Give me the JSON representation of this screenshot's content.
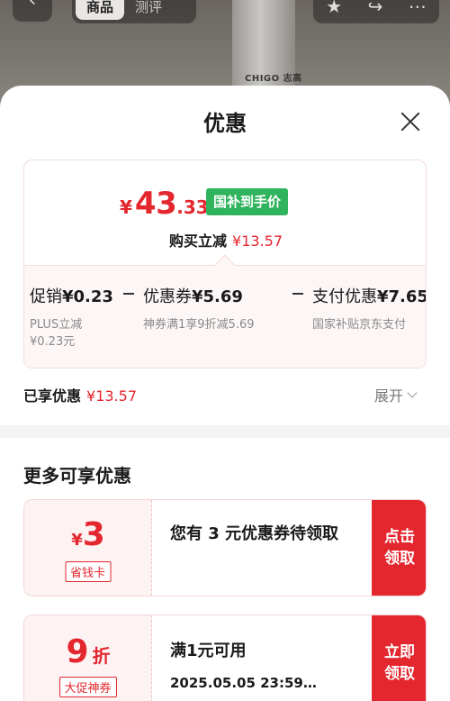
{
  "background": {
    "tabs": [
      "商品",
      "测评"
    ],
    "brand": "CHIGO 志高"
  },
  "sheet": {
    "title": "优惠",
    "price": {
      "currency": "¥",
      "integer": "43",
      "decimal": ".33"
    },
    "gov_badge": "国补到手价",
    "reduce_label": "购买立减",
    "reduce_value": "¥13.57",
    "breakdown": [
      {
        "label": "促销",
        "value": "¥0.23",
        "sub1": "PLUS立减",
        "sub2": "¥0.23元"
      },
      {
        "label": "优惠券",
        "value": "¥5.69",
        "sub1": "神券满1享9折减5.69",
        "sub2": ""
      },
      {
        "label": "支付优惠",
        "value": "¥7.65",
        "sub1": "国家补贴京东支付",
        "sub2": ""
      }
    ],
    "enjoyed_label": "已享优惠",
    "enjoyed_value": "¥13.57",
    "expand_label": "展开",
    "more_title": "更多可享优惠",
    "coupons": [
      {
        "currency": "¥",
        "amount": "3",
        "unit": "",
        "tag": "省钱卡",
        "desc": "您有 3 元优惠券待领取",
        "sub": "",
        "button": "点击领取"
      },
      {
        "currency": "",
        "amount": "9",
        "unit": "折",
        "tag": "大促神券",
        "desc": "满1元可用",
        "sub": "2025.05.05 23:59…",
        "button": "立即领取"
      }
    ]
  },
  "colors": {
    "accent": "#e4262e",
    "badge_green": "#2fb45d"
  }
}
